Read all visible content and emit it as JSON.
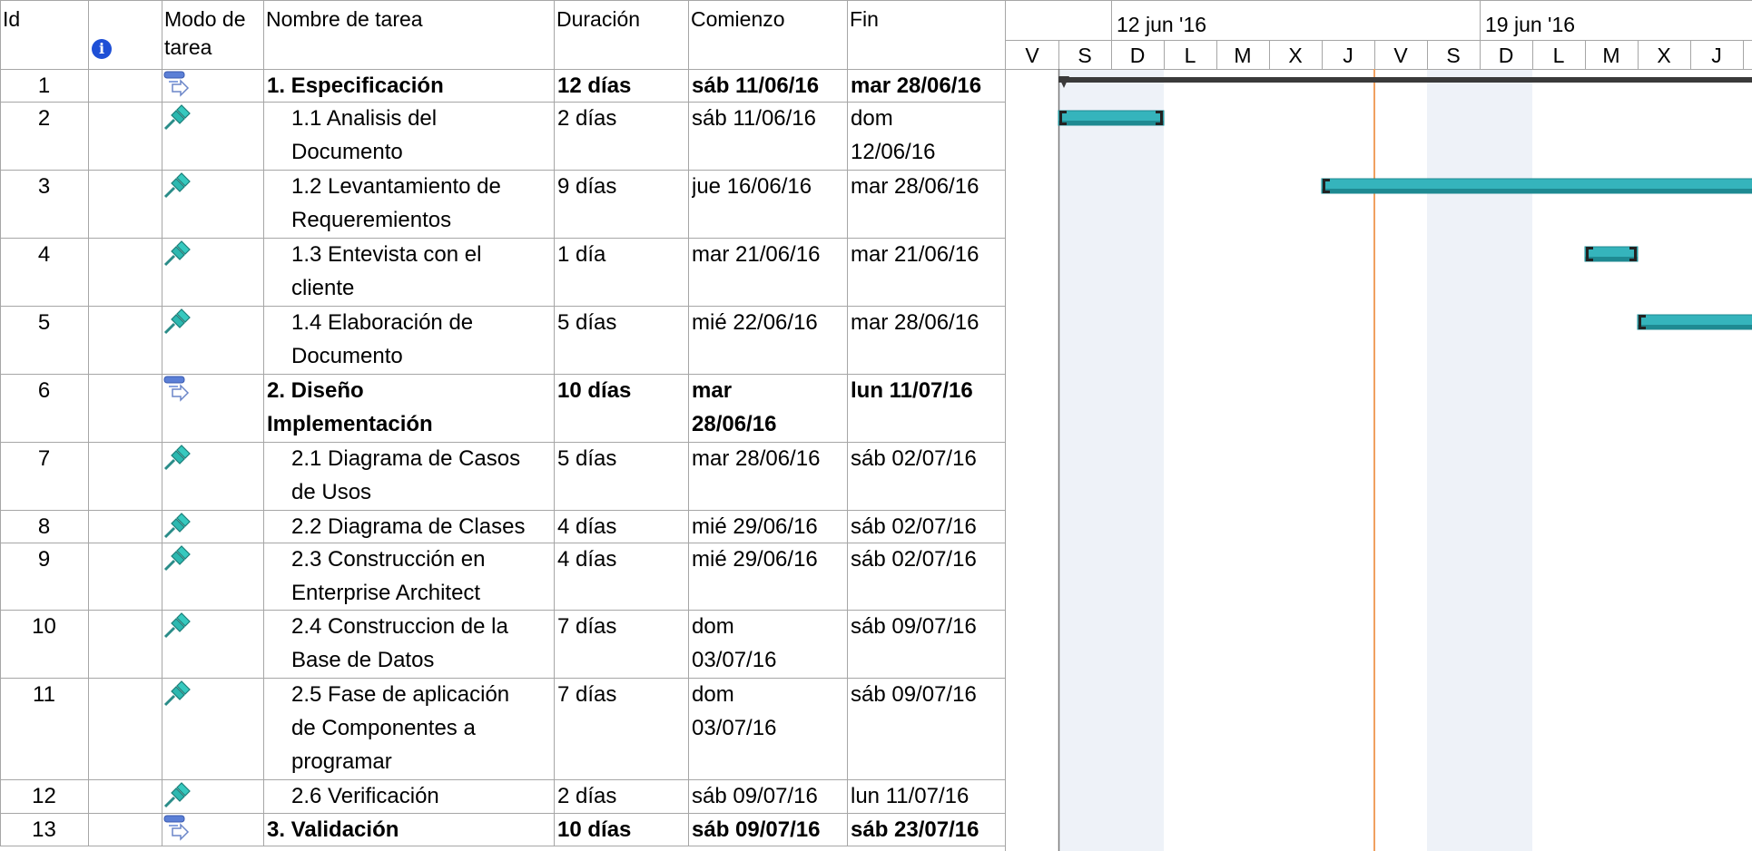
{
  "table": {
    "headers": {
      "id": "Id",
      "mode_line1": "Modo de",
      "mode_line2": "tarea",
      "name": "Nombre de tarea",
      "duration": "Duración",
      "start": "Comienzo",
      "finish": "Fin"
    },
    "rows": [
      {
        "id": "1",
        "mode": "auto-scheduled",
        "summary": true,
        "name": [
          "1. Especificación"
        ],
        "duration": "12 días",
        "start": [
          "sáb 11/06/16"
        ],
        "finish": [
          "mar 28/06/16"
        ]
      },
      {
        "id": "2",
        "mode": "manual",
        "summary": false,
        "name": [
          "1.1 Analisis del",
          "Documento"
        ],
        "duration": "2 días",
        "start": [
          "sáb 11/06/16"
        ],
        "finish": [
          "dom",
          "12/06/16"
        ]
      },
      {
        "id": "3",
        "mode": "manual",
        "summary": false,
        "name": [
          "1.2 Levantamiento de",
          "Requeremientos"
        ],
        "duration": "9 días",
        "start": [
          "jue 16/06/16"
        ],
        "finish": [
          "mar 28/06/16"
        ]
      },
      {
        "id": "4",
        "mode": "manual",
        "summary": false,
        "name": [
          "1.3 Entevista con el",
          "cliente"
        ],
        "duration": "1 día",
        "start": [
          "mar 21/06/16"
        ],
        "finish": [
          "mar 21/06/16"
        ]
      },
      {
        "id": "5",
        "mode": "manual",
        "summary": false,
        "name": [
          "1.4 Elaboración de",
          "Documento"
        ],
        "duration": "5 días",
        "start": [
          "mié 22/06/16"
        ],
        "finish": [
          "mar 28/06/16"
        ]
      },
      {
        "id": "6",
        "mode": "auto-scheduled",
        "summary": true,
        "name": [
          "2. Diseño",
          "Implementación"
        ],
        "duration": "10 días",
        "start": [
          "mar",
          "28/06/16"
        ],
        "finish": [
          "lun 11/07/16"
        ]
      },
      {
        "id": "7",
        "mode": "manual",
        "summary": false,
        "name": [
          " 2.1 Diagrama de Casos",
          "de Usos"
        ],
        "duration": "5 días",
        "start": [
          "mar 28/06/16"
        ],
        "finish": [
          "sáb 02/07/16"
        ]
      },
      {
        "id": "8",
        "mode": "manual",
        "summary": false,
        "name": [
          "2.2 Diagrama de Clases"
        ],
        "duration": "4 días",
        "start": [
          "mié 29/06/16"
        ],
        "finish": [
          "sáb 02/07/16"
        ]
      },
      {
        "id": "9",
        "mode": "manual",
        "summary": false,
        "name": [
          "2.3 Construcción en",
          "Enterprise Architect"
        ],
        "duration": "4 días",
        "start": [
          "mié 29/06/16"
        ],
        "finish": [
          "sáb 02/07/16"
        ]
      },
      {
        "id": "10",
        "mode": "manual",
        "summary": false,
        "name": [
          "2.4 Construccion de la",
          "Base de Datos"
        ],
        "duration": "7 días",
        "start": [
          "dom",
          "03/07/16"
        ],
        "finish": [
          "sáb 09/07/16"
        ]
      },
      {
        "id": "11",
        "mode": "manual",
        "summary": false,
        "name": [
          "2.5 Fase de aplicación",
          "de Componentes a",
          "programar"
        ],
        "duration": "7 días",
        "start": [
          "dom",
          "03/07/16"
        ],
        "finish": [
          "sáb 09/07/16"
        ]
      },
      {
        "id": "12",
        "mode": "manual",
        "summary": false,
        "name": [
          "2.6 Verificación"
        ],
        "duration": "2 días",
        "start": [
          "sáb 09/07/16"
        ],
        "finish": [
          "lun 11/07/16"
        ]
      },
      {
        "id": "13",
        "mode": "auto-scheduled",
        "summary": true,
        "name": [
          "3. Validación"
        ],
        "duration": "10 días",
        "start": [
          "sáb 09/07/16"
        ],
        "finish": [
          "sáb 23/07/16"
        ]
      }
    ]
  },
  "gantt": {
    "weeks": [
      "12 jun '16",
      "19 jun '16"
    ],
    "days": [
      "V",
      "S",
      "D",
      "L",
      "M",
      "X",
      "J",
      "V",
      "S",
      "D",
      "L",
      "M",
      "X",
      "J"
    ],
    "first_day": "2016-06-10",
    "weekend_day_indices": [
      1,
      2,
      8,
      9
    ],
    "today_day_offset": 7.0,
    "colors": {
      "task_bar": "#35b4bc",
      "task_bar_dark": "#1e8a92",
      "summary_bar": "#3a3a3a",
      "today_line": "#f0a060",
      "weekend_shade": "#eef2f8",
      "grid": "#a6a6a6"
    },
    "bars": [
      {
        "row": 1,
        "type": "summary",
        "start": "2016-06-11",
        "end": "2016-06-28"
      },
      {
        "row": 2,
        "type": "task",
        "start": "2016-06-11",
        "end": "2016-06-12"
      },
      {
        "row": 3,
        "type": "task",
        "start": "2016-06-16",
        "end": "2016-06-28"
      },
      {
        "row": 4,
        "type": "task",
        "start": "2016-06-21",
        "end": "2016-06-21"
      },
      {
        "row": 5,
        "type": "task",
        "start": "2016-06-22",
        "end": "2016-06-28"
      }
    ]
  }
}
